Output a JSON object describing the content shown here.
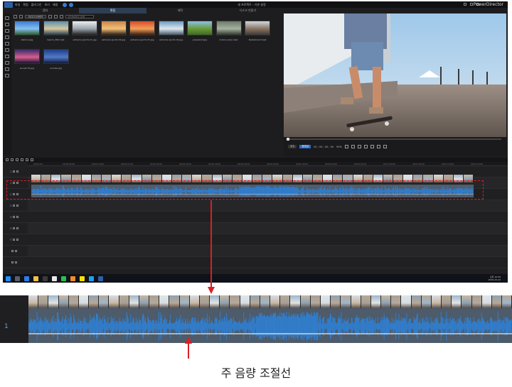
{
  "app": {
    "menu": [
      "파일",
      "편집",
      "플러그인",
      "보기",
      "재생"
    ],
    "doc_title": "새 프로젝트 - 기본 설정",
    "brand": "PowerDirector",
    "mode_tabs": [
      "캡처",
      "편집",
      "제작",
      "디스크 만들기"
    ],
    "active_tab": 1,
    "library_filter": "미디어 컨텐츠",
    "library_search_placeholder": "라이브러리 검색",
    "library_items": [
      {
        "name": "balloon.jpg",
        "colors": [
          "#3a7bd5",
          "#87c0ee",
          "#2b5b2e"
        ]
      },
      {
        "name": "beach_360.mp4",
        "colors": [
          "#5a8fb0",
          "#d7c8a0",
          "#223a4a"
        ]
      },
      {
        "name": "extreme sports 01.jpg",
        "colors": [
          "#e9eef2",
          "#9aa5ad",
          "#202020"
        ]
      },
      {
        "name": "extreme sports 02.jpg",
        "colors": [
          "#c7854b",
          "#f3c078",
          "#2a1d15"
        ]
      },
      {
        "name": "extreme sports 03.jpg",
        "colors": [
          "#d94a2a",
          "#f2a05a",
          "#3c1c12"
        ]
      },
      {
        "name": "extreme sports 04.jpg",
        "colors": [
          "#6d9ac4",
          "#dfe8ef",
          "#475766"
        ]
      },
      {
        "name": "grassland.jpg",
        "colors": [
          "#8cc0e6",
          "#6a9a3a",
          "#3e6b22"
        ]
      },
      {
        "name": "motorcycles.mp4",
        "colors": [
          "#6b7a6a",
          "#a7b2a0",
          "#2f372e"
        ]
      },
      {
        "name": "Skateboard.mp4",
        "colors": [
          "#cfd8df",
          "#8a7563",
          "#3d3a37"
        ]
      },
      {
        "name": "sunset 01.jpg",
        "colors": [
          "#3b2a6e",
          "#d65f8e",
          "#1a1230"
        ]
      },
      {
        "name": "sunrise.jpg",
        "colors": [
          "#1d3f8a",
          "#5478c9",
          "#0e1a3a"
        ]
      }
    ],
    "preview_controls": {
      "clip_label": "클립",
      "movie_label": "동영상",
      "timecode": "00 ; 00 ; 00 ; 00",
      "zoom": "90%"
    },
    "timeline": {
      "ruler_ticks": [
        "00;00;00",
        "00;00;05;00",
        "00;00;10;00",
        "00;00;15;00",
        "00;00;20;00",
        "00;00;25;00",
        "00;00;30;00",
        "00;00;35;00",
        "00;00;40;00",
        "00;00;45;00",
        "00;00;50;00",
        "00;00;55;00",
        "00;01;00;00",
        "00;01;05;00",
        "00;01;10;00",
        "00;01;15;00"
      ],
      "tracks": [
        "1",
        "1",
        "2",
        "2",
        "3",
        "3",
        "T",
        "",
        ""
      ]
    },
    "taskbar_clock": [
      "오전 10:56",
      "2019-10-22"
    ]
  },
  "zoom": {
    "track_label": "1"
  },
  "caption": "주 음량 조절선",
  "colors": {
    "highlight": "#e0191b",
    "arrow": "#d92025",
    "waveform": "#2f7fd1",
    "audio_bg": "#4f5d6d"
  }
}
